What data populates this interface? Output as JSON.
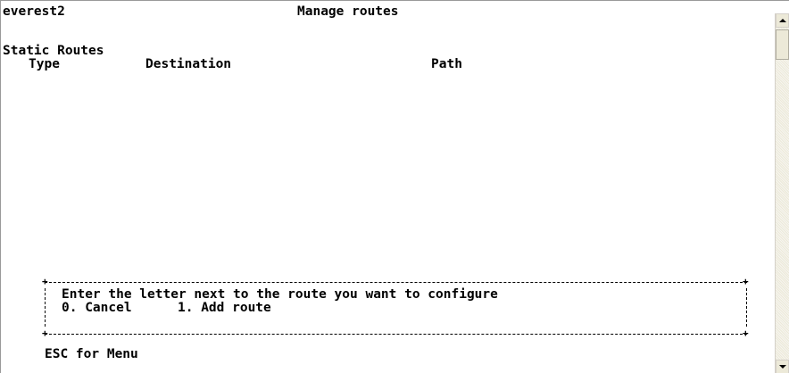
{
  "header": {
    "hostname": "everest2",
    "title": "Manage routes"
  },
  "routes": {
    "section_title": "Static Routes",
    "columns": {
      "type": "Type",
      "destination": "Destination",
      "path": "Path"
    }
  },
  "prompt": {
    "instruction": "Enter the letter next to the route you want to configure",
    "options": [
      {
        "key": "0",
        "label": "0. Cancel"
      },
      {
        "key": "1",
        "label": "1. Add route"
      }
    ]
  },
  "footer": {
    "hint": "ESC for Menu"
  },
  "icons": {
    "scroll_up": "arrow-up-icon",
    "scroll_down": "arrow-down-icon"
  }
}
